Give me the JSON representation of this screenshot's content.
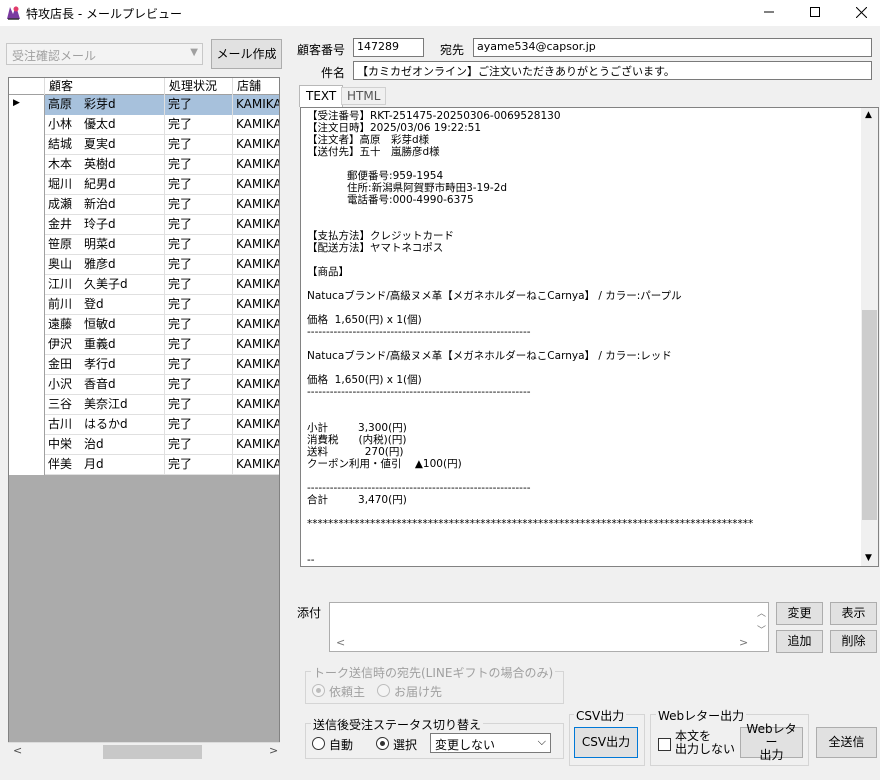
{
  "window": {
    "title": "特攻店長 - メールプレビュー"
  },
  "left": {
    "template_select": "受注確認メール",
    "create_mail_button": "メール作成",
    "columns": [
      "顧客",
      "処理状況",
      "店舗"
    ],
    "rows": [
      {
        "name": "高原　彩芽d",
        "status": "完了",
        "store": "KAMIKAZ",
        "selected": true
      },
      {
        "name": "小林　優太d",
        "status": "完了",
        "store": "KAMIKAZ"
      },
      {
        "name": "結城　夏実d",
        "status": "完了",
        "store": "KAMIKAZ"
      },
      {
        "name": "木本　英樹d",
        "status": "完了",
        "store": "KAMIKAZ"
      },
      {
        "name": "堀川　紀男d",
        "status": "完了",
        "store": "KAMIKAZ"
      },
      {
        "name": "成瀬　新治d",
        "status": "完了",
        "store": "KAMIKAZ"
      },
      {
        "name": "金井　玲子d",
        "status": "完了",
        "store": "KAMIKAZ"
      },
      {
        "name": "笹原　明菜d",
        "status": "完了",
        "store": "KAMIKAZ"
      },
      {
        "name": "奥山　雅彦d",
        "status": "完了",
        "store": "KAMIKAZ"
      },
      {
        "name": "江川　久美子d",
        "status": "完了",
        "store": "KAMIKAZ"
      },
      {
        "name": "前川　登d",
        "status": "完了",
        "store": "KAMIKAZ"
      },
      {
        "name": "遠藤　恒敏d",
        "status": "完了",
        "store": "KAMIKAZ"
      },
      {
        "name": "伊沢　重義d",
        "status": "完了",
        "store": "KAMIKAZ"
      },
      {
        "name": "金田　孝行d",
        "status": "完了",
        "store": "KAMIKAZ"
      },
      {
        "name": "小沢　香音d",
        "status": "完了",
        "store": "KAMIKAZ"
      },
      {
        "name": "三谷　美奈江d",
        "status": "完了",
        "store": "KAMIKAZ"
      },
      {
        "name": "古川　はるかd",
        "status": "完了",
        "store": "KAMIKAZ"
      },
      {
        "name": "中栄　治d",
        "status": "完了",
        "store": "KAMIKAZ"
      },
      {
        "name": "伴美　月d",
        "status": "完了",
        "store": "KAMIKAZ"
      }
    ]
  },
  "header": {
    "customer_no_label": "顧客番号",
    "customer_no": "147289",
    "to_label": "宛先",
    "to": "ayame534@capsor.jp",
    "subject_label": "件名",
    "subject": "【カミカゼオンライン】ご注文いただきありがとうございます。"
  },
  "tabs": [
    "TEXT",
    "HTML"
  ],
  "mail_body": [
    {
      "t": "【受注番号】RKT-251475-20250306-0069528130"
    },
    {
      "t": "【注文日時】2025/03/06 19:22:51"
    },
    {
      "t": "【注文者】高原　彩芽d様"
    },
    {
      "t": "【送付先】五十　嵐勝彦d様"
    },
    {
      "t": "            郵便番号:959-1954"
    },
    {
      "t": "            住所:新潟県阿賀野市畤田3-19-2d"
    },
    {
      "t": "            電話番号:000-4990-6375"
    },
    {
      "t": "【支払方法】クレジットカード"
    },
    {
      "t": "【配送方法】ヤマトネコポス"
    },
    {
      "t": "【商品】"
    },
    {
      "t": "Natucaブランド/高級ヌメ革【メガネホルダーねこCarnya】 / カラー:パープル"
    },
    {
      "t": "価格  1,650(円) x 1(個)"
    },
    {
      "t": "-----------------------------------------------------------"
    },
    {
      "t": "Natucaブランド/高級ヌメ革【メガネホルダーねこCarnya】 / カラー:レッド"
    },
    {
      "t": "価格  1,650(円) x 1(個)"
    },
    {
      "t": "-----------------------------------------------------------"
    },
    {
      "t": "小計         3,300(円)"
    },
    {
      "t": "消費税      (内税)(円)"
    },
    {
      "t": "送料           270(円)"
    },
    {
      "t": "クーポン利用・値引    ▲100(円)"
    },
    {
      "t": "-----------------------------------------------------------"
    },
    {
      "t": "合計         3,470(円)"
    },
    {
      "t": "*************************************************************************************"
    },
    {
      "t": "--"
    }
  ],
  "attach": {
    "label": "添付",
    "change_button": "変更",
    "show_button": "表示",
    "add_button": "追加",
    "delete_button": "削除"
  },
  "line_gift": {
    "title": "トーク送信時の宛先(LINEギフトの場合のみ)",
    "opt1": "依頼主",
    "opt2": "お届け先"
  },
  "status_switch": {
    "title": "送信後受注ステータス切り替え",
    "opt_auto": "自動",
    "opt_select": "選択",
    "select_value": "変更しない"
  },
  "csv": {
    "title": "CSV出力",
    "button": "CSV出力"
  },
  "web_letter": {
    "title": "Webレター出力",
    "checkbox_label_1": "本文を",
    "checkbox_label_2": "出力しない",
    "button_1": "Webレター",
    "button_2": "出力"
  },
  "send_all_button": "全送信"
}
